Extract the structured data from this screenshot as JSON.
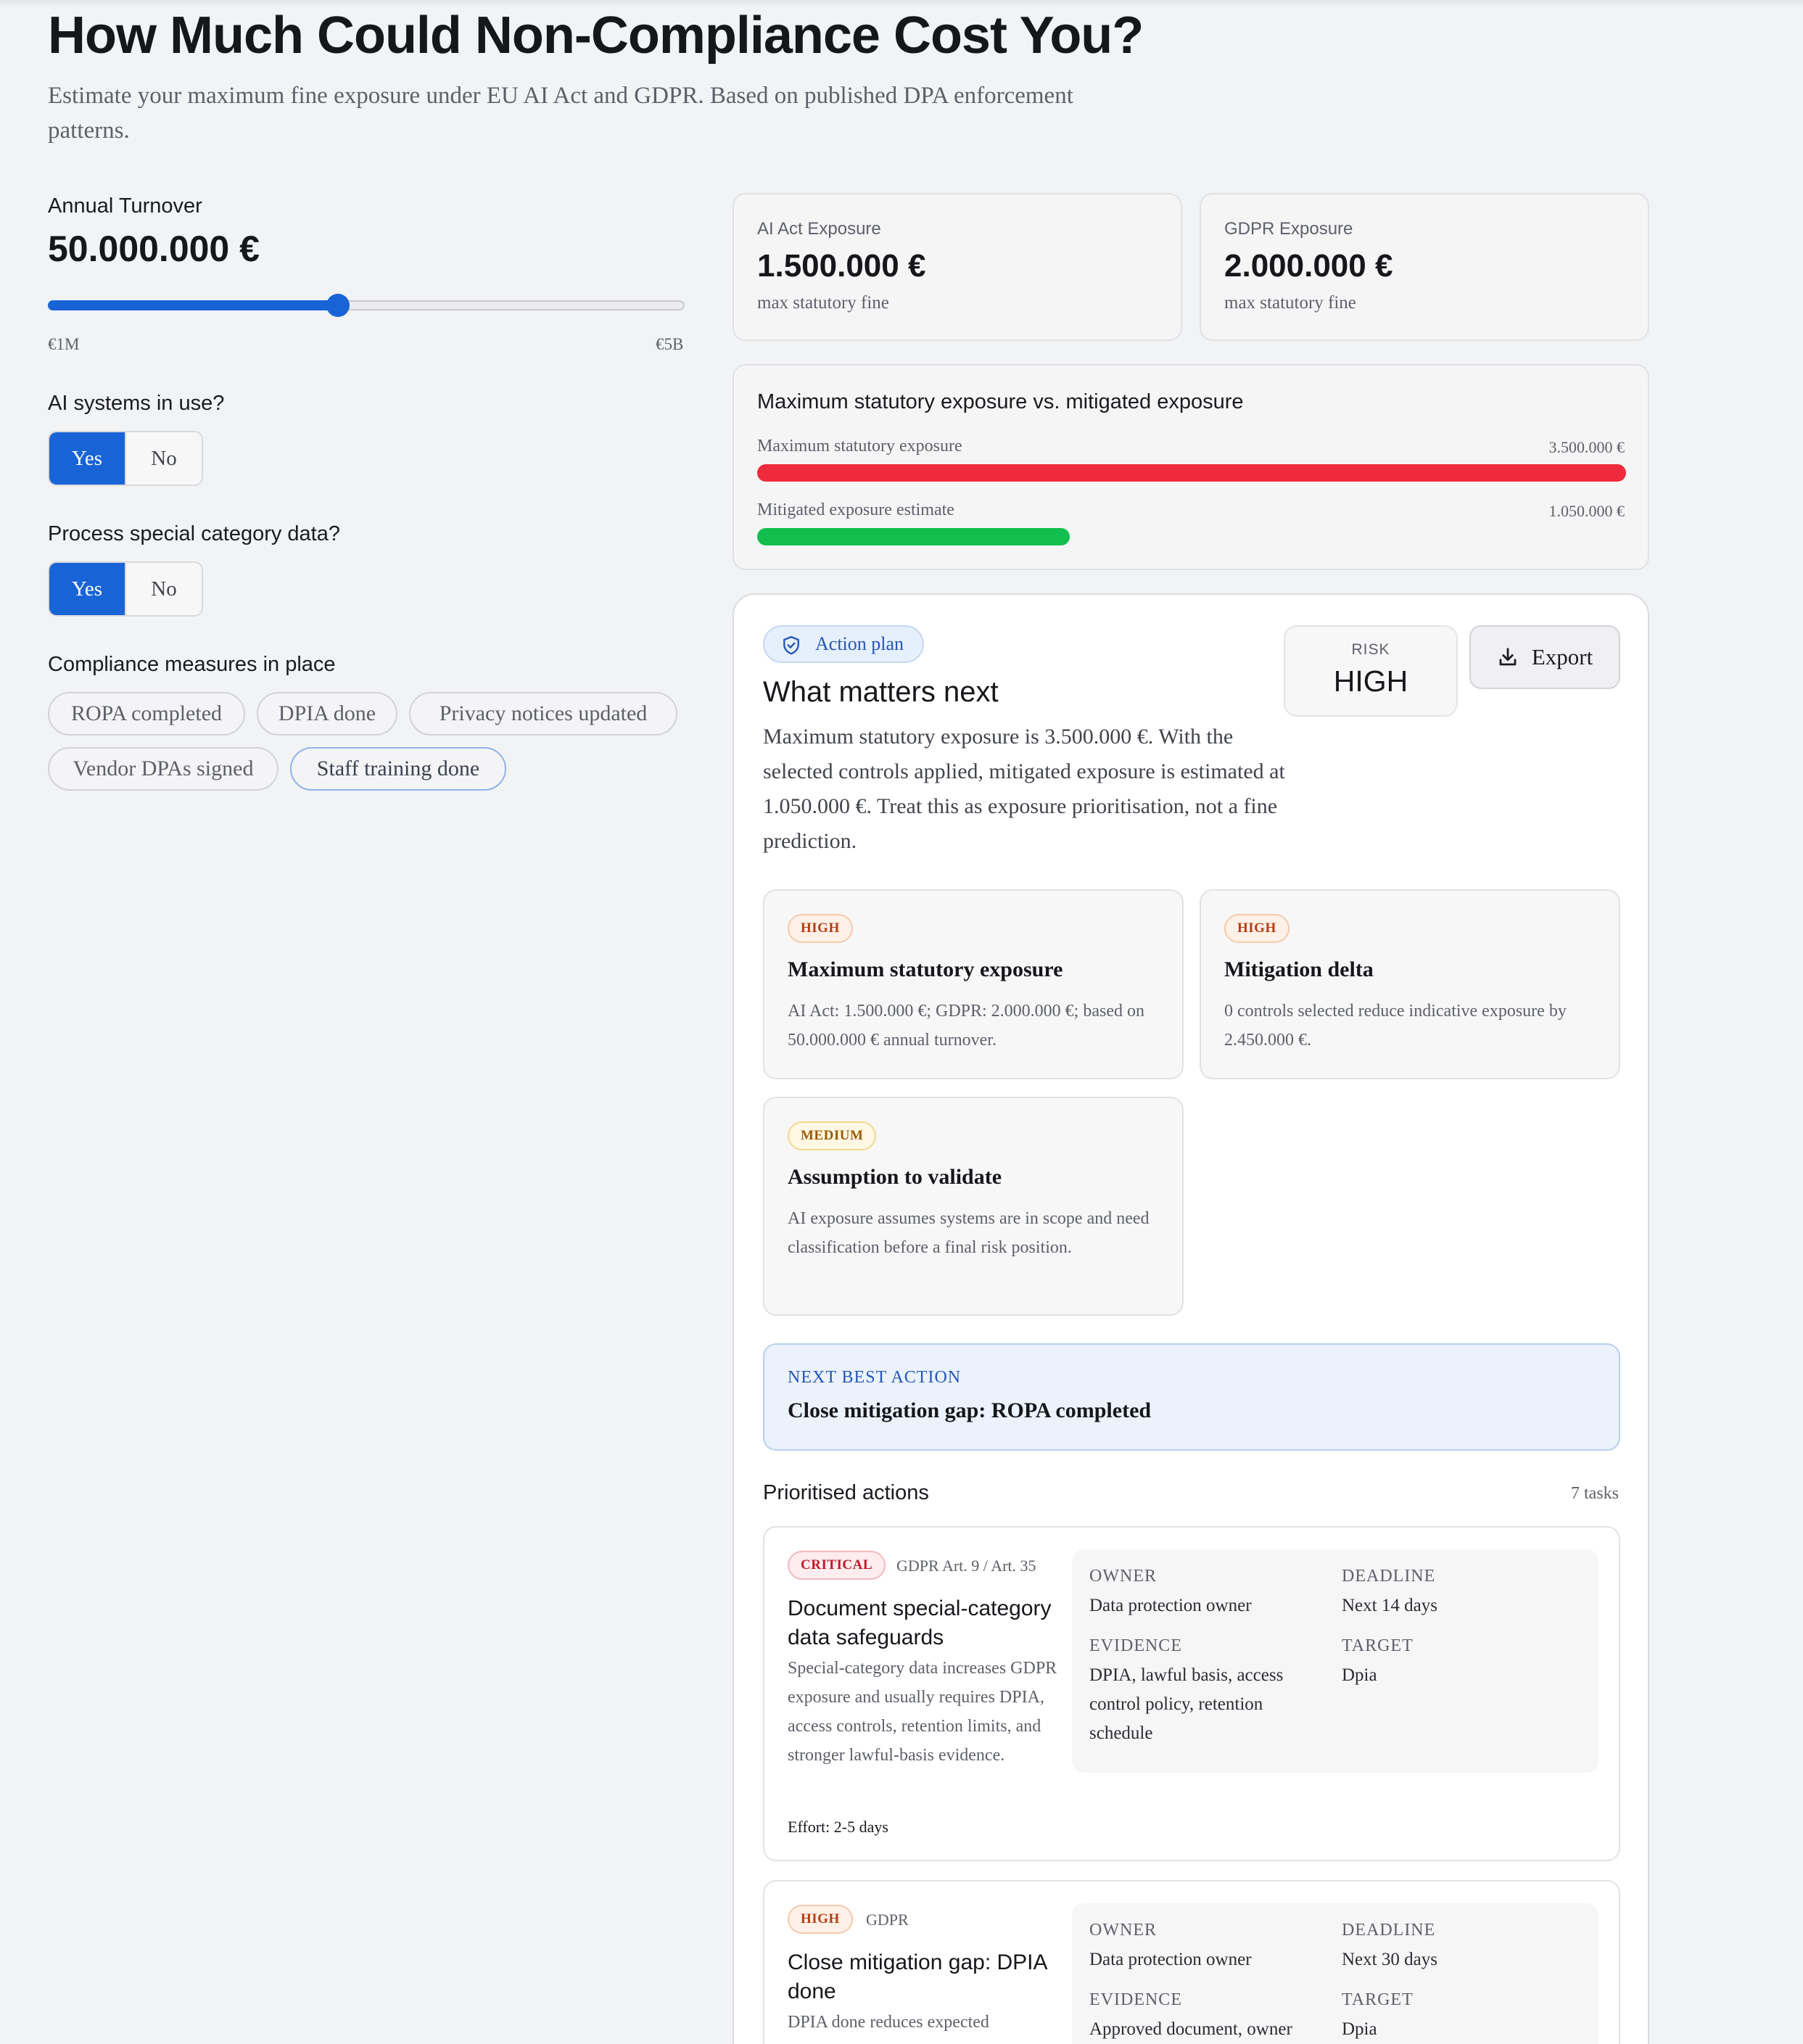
{
  "header": {
    "title": "How Much Could Non-Compliance Cost You?",
    "subtitle": "Estimate your maximum fine exposure under EU AI Act and GDPR. Based on published DPA enforcement patterns."
  },
  "inputs": {
    "turnover_label": "Annual Turnover",
    "turnover_value": "50.000.000 €",
    "slider_min": "€1M",
    "slider_max": "€5B",
    "slider_fraction": 0.456,
    "ai_label": "AI systems in use?",
    "ai_yes": "Yes",
    "ai_no": "No",
    "ai_selected": "Yes",
    "special_label": "Process special category data?",
    "special_yes": "Yes",
    "special_no": "No",
    "special_selected": "Yes",
    "measures_label": "Compliance measures in place",
    "measures": [
      "ROPA completed",
      "DPIA done",
      "Privacy notices updated",
      "Vendor DPAs signed",
      "Staff training done"
    ]
  },
  "summary": {
    "ai_label": "AI Act Exposure",
    "ai_value": "1.500.000 €",
    "ai_sub": "max statutory fine",
    "gdpr_label": "GDPR Exposure",
    "gdpr_value": "2.000.000 €",
    "gdpr_sub": "max statutory fine"
  },
  "comparison": {
    "title": "Maximum statutory exposure vs. mitigated exposure",
    "max_label": "Maximum statutory exposure",
    "max_value": "3.500.000 €",
    "max_fraction": 1.0,
    "mit_label": "Mitigated exposure estimate",
    "mit_value": "1.050.000 €",
    "mit_fraction": 0.3,
    "colors": {
      "max": "#ef2b3b",
      "mitigated": "#12bf4e"
    }
  },
  "plan": {
    "pill": "Action plan",
    "heading": "What matters next",
    "paragraph": "Maximum statutory exposure is 3.500.000 €. With the selected controls applied, mitigated exposure is estimated at 1.050.000 €. Treat this as exposure prioritisation, not a fine prediction.",
    "risk_label": "RISK",
    "risk_value": "HIGH",
    "export_label": "Export",
    "insights": [
      {
        "badge": "HIGH",
        "title": "Maximum statutory exposure",
        "text": "AI Act: 1.500.000 €; GDPR: 2.000.000 €; based on 50.000.000 € annual turnover."
      },
      {
        "badge": "HIGH",
        "title": "Mitigation delta",
        "text": "0 controls selected reduce indicative exposure by 2.450.000 €."
      },
      {
        "badge": "MEDIUM",
        "title": "Assumption to validate",
        "text": "AI exposure assumes systems are in scope and need classification before a final risk position."
      }
    ],
    "next_best_label": "NEXT BEST ACTION",
    "next_best_value": "Close mitigation gap: ROPA completed",
    "prioritised_label": "Prioritised actions",
    "task_count": "7 tasks",
    "tasks": [
      {
        "badge": "CRITICAL",
        "ref": "GDPR Art. 9 / Art. 35",
        "title": "Document special-category data safeguards",
        "desc": "Special-category data increases GDPR exposure and usually requires DPIA, access controls, retention limits, and stronger lawful-basis evidence.",
        "effort": "Effort: 2-5 days",
        "owner_label": "OWNER",
        "owner": "Data protection owner",
        "deadline_label": "DEADLINE",
        "deadline": "Next 14 days",
        "evidence_label": "EVIDENCE",
        "evidence": "DPIA, lawful basis, access control policy, retention schedule",
        "target_label": "TARGET",
        "target": "Dpia"
      },
      {
        "badge": "HIGH",
        "ref": "GDPR",
        "title": "Close mitigation gap: DPIA done",
        "desc": "DPIA done reduces expected",
        "owner_label": "OWNER",
        "owner": "Data protection owner",
        "deadline_label": "DEADLINE",
        "deadline": "Next 30 days",
        "evidence_label": "EVIDENCE",
        "evidence": "Approved document, owner",
        "target_label": "TARGET",
        "target": "Dpia"
      }
    ]
  }
}
